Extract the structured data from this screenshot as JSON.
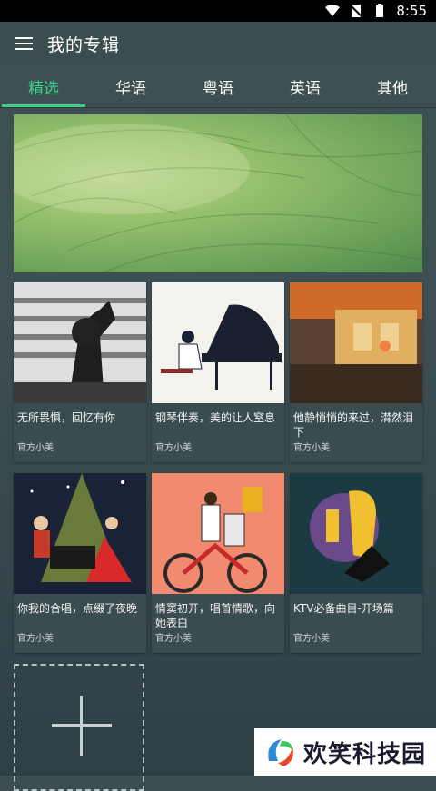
{
  "status_bar": {
    "time": "8:55"
  },
  "toolbar": {
    "title": "我的专辑",
    "menu_icon": "hamburger-menu-icon"
  },
  "tabs": [
    {
      "label": "精选",
      "active": true
    },
    {
      "label": "华语",
      "active": false
    },
    {
      "label": "粤语",
      "active": false
    },
    {
      "label": "英语",
      "active": false
    },
    {
      "label": "其他",
      "active": false
    }
  ],
  "albums": [
    {
      "name": "无所畏惧，回忆有你",
      "author": "官方小美"
    },
    {
      "name": "钢琴伴奏，美的让人窒息",
      "author": "官方小美"
    },
    {
      "name": "他静悄悄的来过，潸然泪下",
      "author": "官方小美"
    },
    {
      "name": "你我的合唱，点缀了夜晚",
      "author": "官方小美"
    },
    {
      "name": "情窦初开，唱首情歌，向她表白",
      "author": "官方小美"
    },
    {
      "name": "KTV必备曲目-开场篇",
      "author": "官方小美"
    }
  ],
  "watermark": {
    "text": "欢笑科技园"
  },
  "colors": {
    "accent": "#3dd28a",
    "background": "#3c4d50"
  }
}
